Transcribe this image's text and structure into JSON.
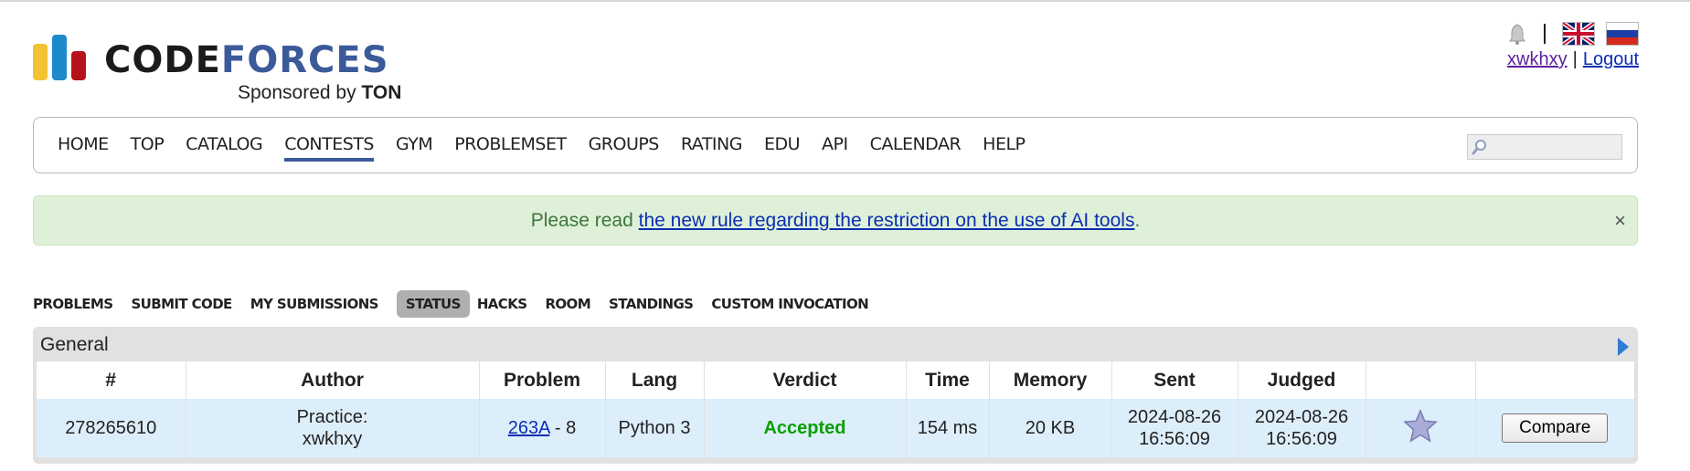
{
  "header": {
    "logo_code": "CODE",
    "logo_forces": "FORCES",
    "sponsored_by": "Sponsored by",
    "sponsor": "TON",
    "username": "xwkhxy",
    "logout": "Logout",
    "separator": "|"
  },
  "menu": {
    "items": [
      "HOME",
      "TOP",
      "CATALOG",
      "CONTESTS",
      "GYM",
      "PROBLEMSET",
      "GROUPS",
      "RATING",
      "EDU",
      "API",
      "CALENDAR",
      "HELP"
    ],
    "active": "CONTESTS",
    "search_placeholder": ""
  },
  "alert": {
    "prefix": "Please read ",
    "link": "the new rule regarding the restriction on the use of AI tools",
    "suffix": ".",
    "close": "×"
  },
  "second_menu": {
    "items": [
      "PROBLEMS",
      "SUBMIT CODE",
      "MY SUBMISSIONS",
      "STATUS",
      "HACKS",
      "ROOM",
      "STANDINGS",
      "CUSTOM INVOCATION"
    ],
    "active": "STATUS"
  },
  "status": {
    "frame_title": "General",
    "columns": [
      "#",
      "Author",
      "Problem",
      "Lang",
      "Verdict",
      "Time",
      "Memory",
      "Sent",
      "Judged",
      "",
      ""
    ],
    "row": {
      "id": "278265610",
      "author_line1": "Practice:",
      "author_line2": "xwkhxy",
      "problem_link": "263A",
      "problem_suffix": " - 8",
      "lang": "Python 3",
      "verdict": "Accepted",
      "time": "154 ms",
      "memory": "20 KB",
      "sent_date": "2024-08-26",
      "sent_time": "16:56:09",
      "judged_date": "2024-08-26",
      "judged_time": "16:56:09",
      "compare": "Compare"
    }
  },
  "colors": {
    "accepted": "#0a9f00",
    "link": "#0a2eb3",
    "alert_bg": "#dff0d8",
    "row_bg": "#ddeefb"
  }
}
